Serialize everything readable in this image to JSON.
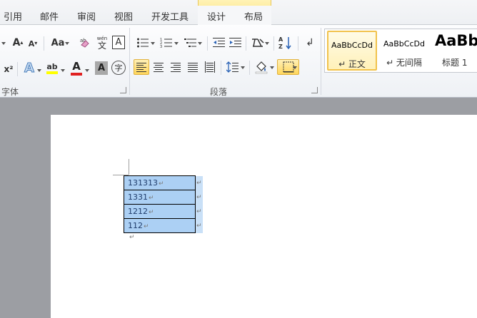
{
  "tabs": {
    "items": [
      "引用",
      "邮件",
      "审阅",
      "视图",
      "开发工具",
      "设计",
      "布局"
    ]
  },
  "ribbon": {
    "font_group_label": "字体",
    "paragraph_group_label": "段落",
    "font_icons": {
      "grow_font": "A",
      "shrink_font": "A",
      "change_case": "Aa",
      "phonetic_guide": "wén",
      "char_border": "A",
      "superscript": "x²",
      "text_effects": "A",
      "highlight": "ab",
      "font_color": "A",
      "char_shading": "A",
      "enclose_char": "字"
    },
    "styles": [
      {
        "preview": "AaBbCcDd",
        "name": "↵ 正文"
      },
      {
        "preview": "AaBbCcDd",
        "name": "↵ 无间隔"
      },
      {
        "preview": "AaBb",
        "name": "标题 1"
      }
    ]
  },
  "document": {
    "table_rows": [
      "131313",
      "1331",
      "1212",
      "112"
    ],
    "paragraph_mark": "↵"
  },
  "colors": {
    "selection": "#acd0f4",
    "accent": "#ffd65b",
    "font_color_bar": "#e02020",
    "highlight_bar": "#ffff00"
  }
}
